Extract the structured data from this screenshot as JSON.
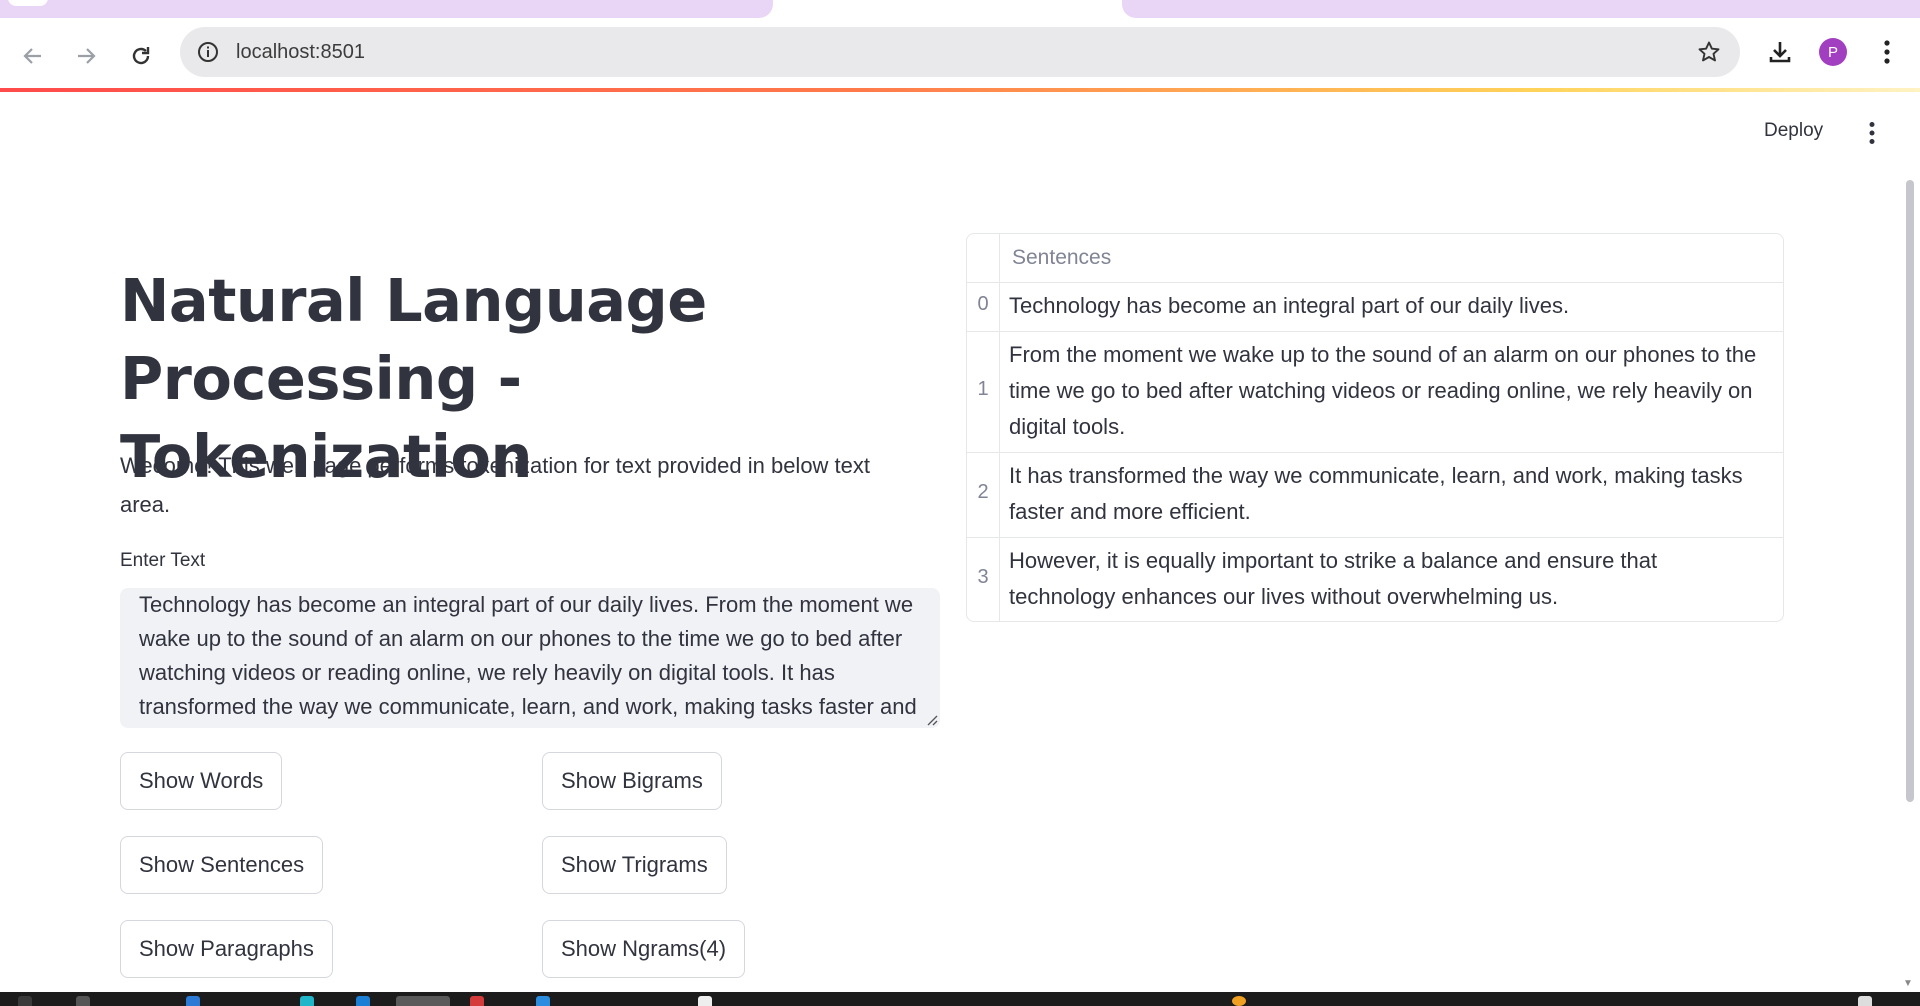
{
  "browser": {
    "url": "localhost:8501",
    "avatar_initial": "P"
  },
  "app": {
    "deploy_label": "Deploy",
    "title": "Natural Language Processing - Tokenization",
    "intro": "Wecome! This web page performs tokenization for text provided in below text area.",
    "input_label": "Enter Text",
    "input_value": "Technology has become an integral part of our daily lives. From the moment we wake up to the sound of an alarm on our phones to the time we go to bed after watching videos or reading online, we rely heavily on digital tools. It has transformed the way we communicate, learn, and work, making tasks faster and more efficient. However, it is equally important to strike a balance and ensure that technology enhances our lives without overwhelming us.",
    "buttons": {
      "show_words": "Show Words",
      "show_bigrams": "Show Bigrams",
      "show_sentences": "Show Sentences",
      "show_trigrams": "Show Trigrams",
      "show_paragraphs": "Show Paragraphs",
      "show_ngrams": "Show Ngrams(4)"
    }
  },
  "table": {
    "column_header": "Sentences",
    "rows": [
      {
        "index": "0",
        "text": "Technology has become an integral part of our daily lives."
      },
      {
        "index": "1",
        "text": "From the moment we wake up to the sound of an alarm on our phones to the time we go to bed after watching videos or reading online, we rely heavily on digital tools."
      },
      {
        "index": "2",
        "text": "It has transformed the way we communicate, learn, and work, making tasks faster and more efficient."
      },
      {
        "index": "3",
        "text": "However, it is equally important to strike a balance and ensure that technology enhances our lives without overwhelming us."
      }
    ]
  },
  "colors": {
    "accent_gradient_start": "#ff4b4b",
    "accent_gradient_end": "#fff3c4",
    "tab_strip": "#e9d5f5",
    "avatar": "#a23fc0",
    "text": "#31333f"
  }
}
